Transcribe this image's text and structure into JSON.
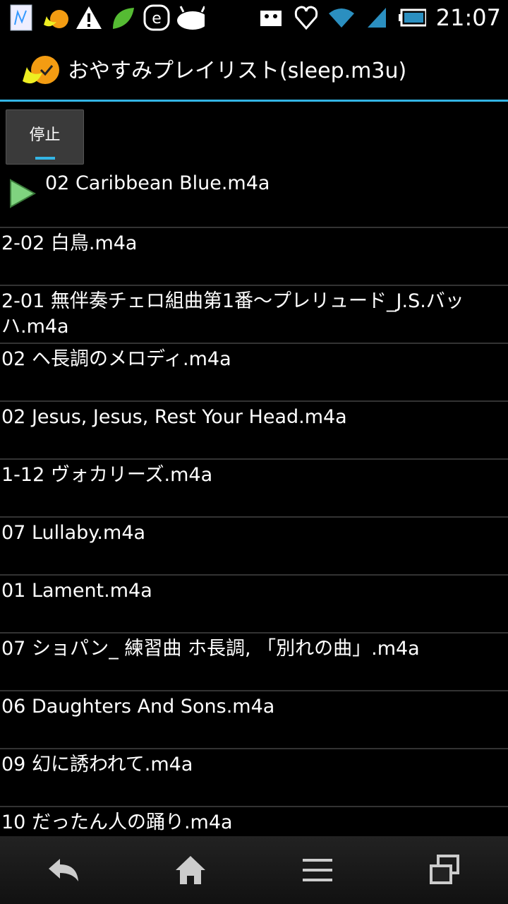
{
  "status_bar": {
    "time": "21:07",
    "left_icons": [
      "notepad-icon",
      "app-moon-icon",
      "warning-icon",
      "leaf-icon",
      "e-icon",
      "android-icon"
    ],
    "right_icons": [
      "voicemail-icon",
      "heart-icon",
      "wifi-icon",
      "signal-icon",
      "battery-icon"
    ]
  },
  "action_bar": {
    "title": "おやすみプレイリスト(sleep.m3u)"
  },
  "stop_button": {
    "label": "停止"
  },
  "playlist": [
    "02 Caribbean Blue.m4a",
    "2-02 白鳥.m4a",
    "2-01 無伴奏チェロ組曲第1番〜プレリュード_J.S.バッハ.m4a",
    "02 ヘ長調のメロディ.m4a",
    "02 Jesus, Jesus, Rest Your Head.m4a",
    "1-12 ヴォカリーズ.m4a",
    "07 Lullaby.m4a",
    "01 Lament.m4a",
    "07 ショパン_ 練習曲 ホ長調, 「別れの曲」.m4a",
    "06 Daughters And Sons.m4a",
    "09 幻に誘われて.m4a",
    "10 だったん人の踊り.m4a"
  ],
  "colors": {
    "accent": "#33b5e5",
    "play": "#7fd37f"
  }
}
